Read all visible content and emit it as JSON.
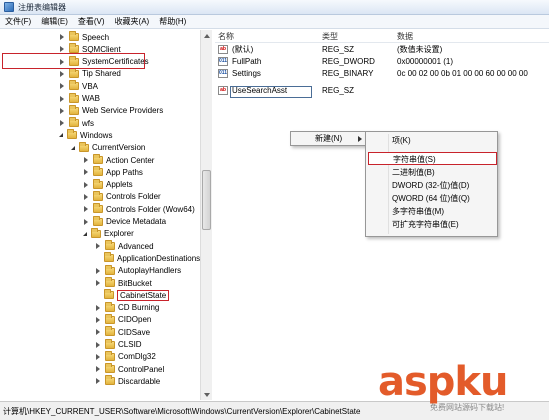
{
  "window": {
    "title": "注册表编辑器"
  },
  "menu": [
    "文件(F)",
    "编辑(E)",
    "查看(V)",
    "收藏夹(A)",
    "帮助(H)"
  ],
  "tree": [
    {
      "label": "Speech",
      "indent": 0,
      "state": "collapsed"
    },
    {
      "label": "SQMClient",
      "indent": 0,
      "state": "collapsed"
    },
    {
      "label": "SystemCertificates",
      "indent": 0,
      "state": "collapsed"
    },
    {
      "label": "Tip Shared",
      "indent": 0,
      "state": "collapsed"
    },
    {
      "label": "VBA",
      "indent": 0,
      "state": "collapsed"
    },
    {
      "label": "WAB",
      "indent": 0,
      "state": "collapsed"
    },
    {
      "label": "Web Service Providers",
      "indent": 0,
      "state": "collapsed"
    },
    {
      "label": "wfs",
      "indent": 0,
      "state": "collapsed"
    },
    {
      "label": "Windows",
      "indent": 0,
      "state": "expanded"
    },
    {
      "label": "CurrentVersion",
      "indent": 1,
      "state": "expanded"
    },
    {
      "label": "Action Center",
      "indent": 2,
      "state": "collapsed"
    },
    {
      "label": "App Paths",
      "indent": 2,
      "state": "collapsed"
    },
    {
      "label": "Applets",
      "indent": 2,
      "state": "collapsed"
    },
    {
      "label": "Controls Folder",
      "indent": 2,
      "state": "collapsed"
    },
    {
      "label": "Controls Folder (Wow64)",
      "indent": 2,
      "state": "collapsed"
    },
    {
      "label": "Device Metadata",
      "indent": 2,
      "state": "collapsed"
    },
    {
      "label": "Explorer",
      "indent": 2,
      "state": "expanded"
    },
    {
      "label": "Advanced",
      "indent": 3,
      "state": "collapsed"
    },
    {
      "label": "ApplicationDestinations",
      "indent": 3,
      "state": "none"
    },
    {
      "label": "AutoplayHandlers",
      "indent": 3,
      "state": "collapsed"
    },
    {
      "label": "BitBucket",
      "indent": 3,
      "state": "collapsed"
    },
    {
      "label": "CabinetState",
      "indent": 3,
      "state": "none",
      "selected": true
    },
    {
      "label": "CD Burning",
      "indent": 3,
      "state": "collapsed"
    },
    {
      "label": "CIDOpen",
      "indent": 3,
      "state": "collapsed"
    },
    {
      "label": "CIDSave",
      "indent": 3,
      "state": "collapsed"
    },
    {
      "label": "CLSID",
      "indent": 3,
      "state": "collapsed"
    },
    {
      "label": "ComDlg32",
      "indent": 3,
      "state": "collapsed"
    },
    {
      "label": "ControlPanel",
      "indent": 3,
      "state": "collapsed"
    },
    {
      "label": "Discardable",
      "indent": 3,
      "state": "collapsed"
    }
  ],
  "list": {
    "headers": [
      "名称",
      "类型",
      "数据"
    ],
    "rows": [
      {
        "name": "(默认)",
        "type": "REG_SZ",
        "data": "(数值未设置)",
        "icon": "string"
      },
      {
        "name": "FullPath",
        "type": "REG_DWORD",
        "data": "0x00000001 (1)",
        "icon": "binary"
      },
      {
        "name": "Settings",
        "type": "REG_BINARY",
        "data": "0c 00 02 00 0b 01 00 00 60 00 00 00",
        "icon": "binary"
      },
      {
        "name": "UseSearchAsst",
        "type": "REG_SZ",
        "data": "",
        "icon": "string",
        "editing": true
      }
    ]
  },
  "context_menu": {
    "new_label": "新建(N)"
  },
  "submenu": [
    "项(K)",
    "字符串值(S)",
    "二进制值(B)",
    "DWORD (32-位)值(D)",
    "QWORD (64 位)值(Q)",
    "多字符串值(M)",
    "可扩充字符串值(E)"
  ],
  "status": {
    "path": "计算机\\HKEY_CURRENT_USER\\Software\\Microsoft\\Windows\\CurrentVersion\\Explorer\\CabinetState"
  },
  "watermark": {
    "brand": "aspku",
    "sub": "免费网站源码下载站!"
  },
  "colors": {
    "highlight_border": "#c8232b",
    "folder": "#e2b43e",
    "watermark": "#e35b2a"
  }
}
